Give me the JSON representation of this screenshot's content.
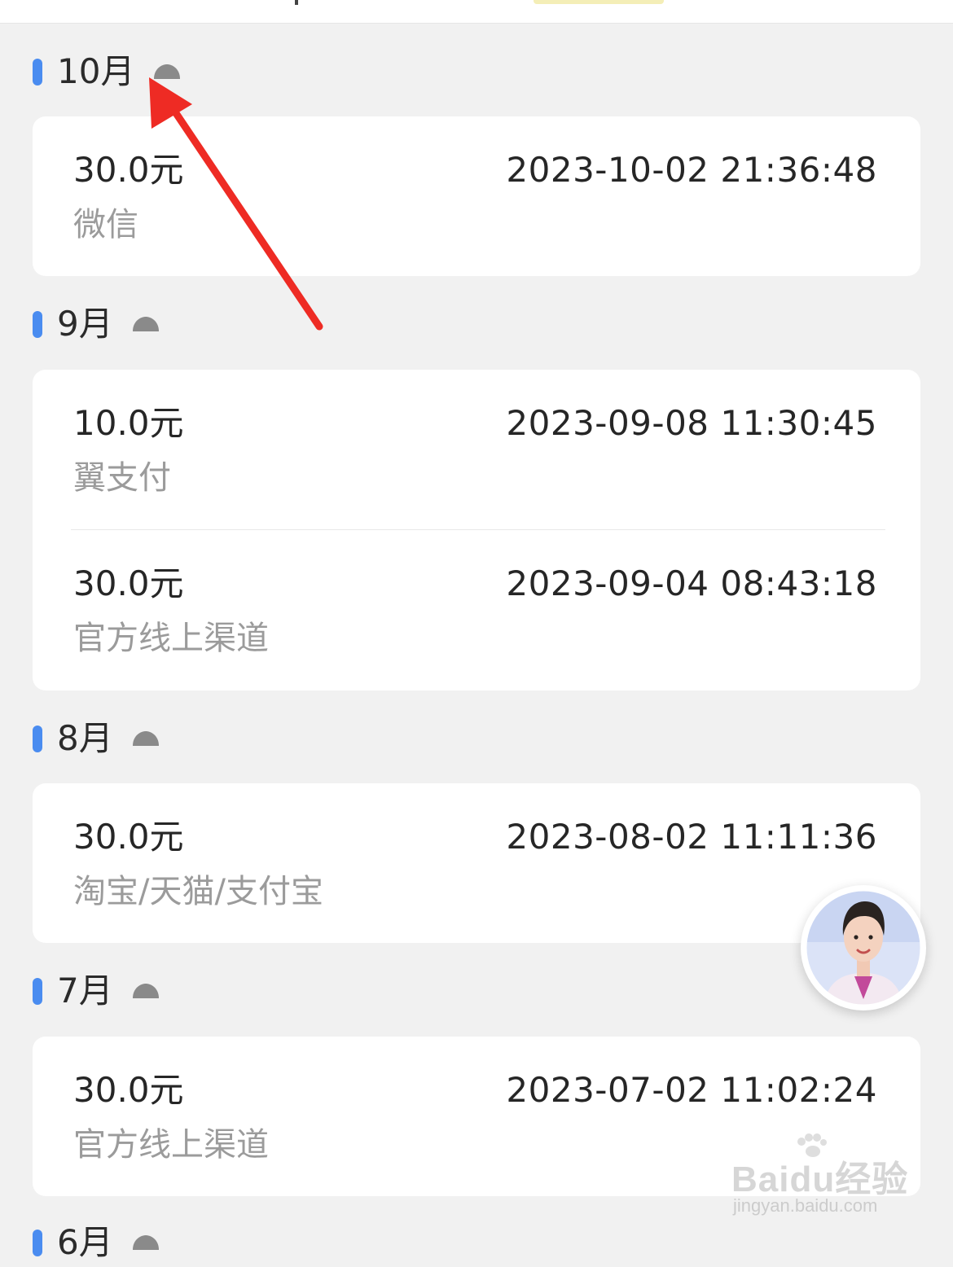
{
  "currency_suffix": "元",
  "groups": [
    {
      "month": "10月",
      "records": [
        {
          "amount": "30.0元",
          "time": "2023-10-02 21:36:48",
          "channel": "微信"
        }
      ]
    },
    {
      "month": "9月",
      "records": [
        {
          "amount": "10.0元",
          "time": "2023-09-08 11:30:45",
          "channel": "翼支付"
        },
        {
          "amount": "30.0元",
          "time": "2023-09-04 08:43:18",
          "channel": "官方线上渠道"
        }
      ]
    },
    {
      "month": "8月",
      "records": [
        {
          "amount": "30.0元",
          "time": "2023-08-02 11:11:36",
          "channel": "淘宝/天猫/支付宝"
        }
      ]
    },
    {
      "month": "7月",
      "records": [
        {
          "amount": "30.0元",
          "time": "2023-07-02 11:02:24",
          "channel": "官方线上渠道"
        }
      ]
    },
    {
      "month": "6月",
      "records": []
    }
  ],
  "watermark": {
    "brand": "Baidu经验",
    "url": "jingyan.baidu.com"
  },
  "colors": {
    "accent": "#4a8cf0",
    "annotation_arrow": "#ee2b24",
    "background": "#f1f1f1",
    "card": "#ffffff"
  },
  "icons": {
    "collapse": "caret-up-icon",
    "service": "customer-service-avatar",
    "annotation": "red-arrow"
  }
}
